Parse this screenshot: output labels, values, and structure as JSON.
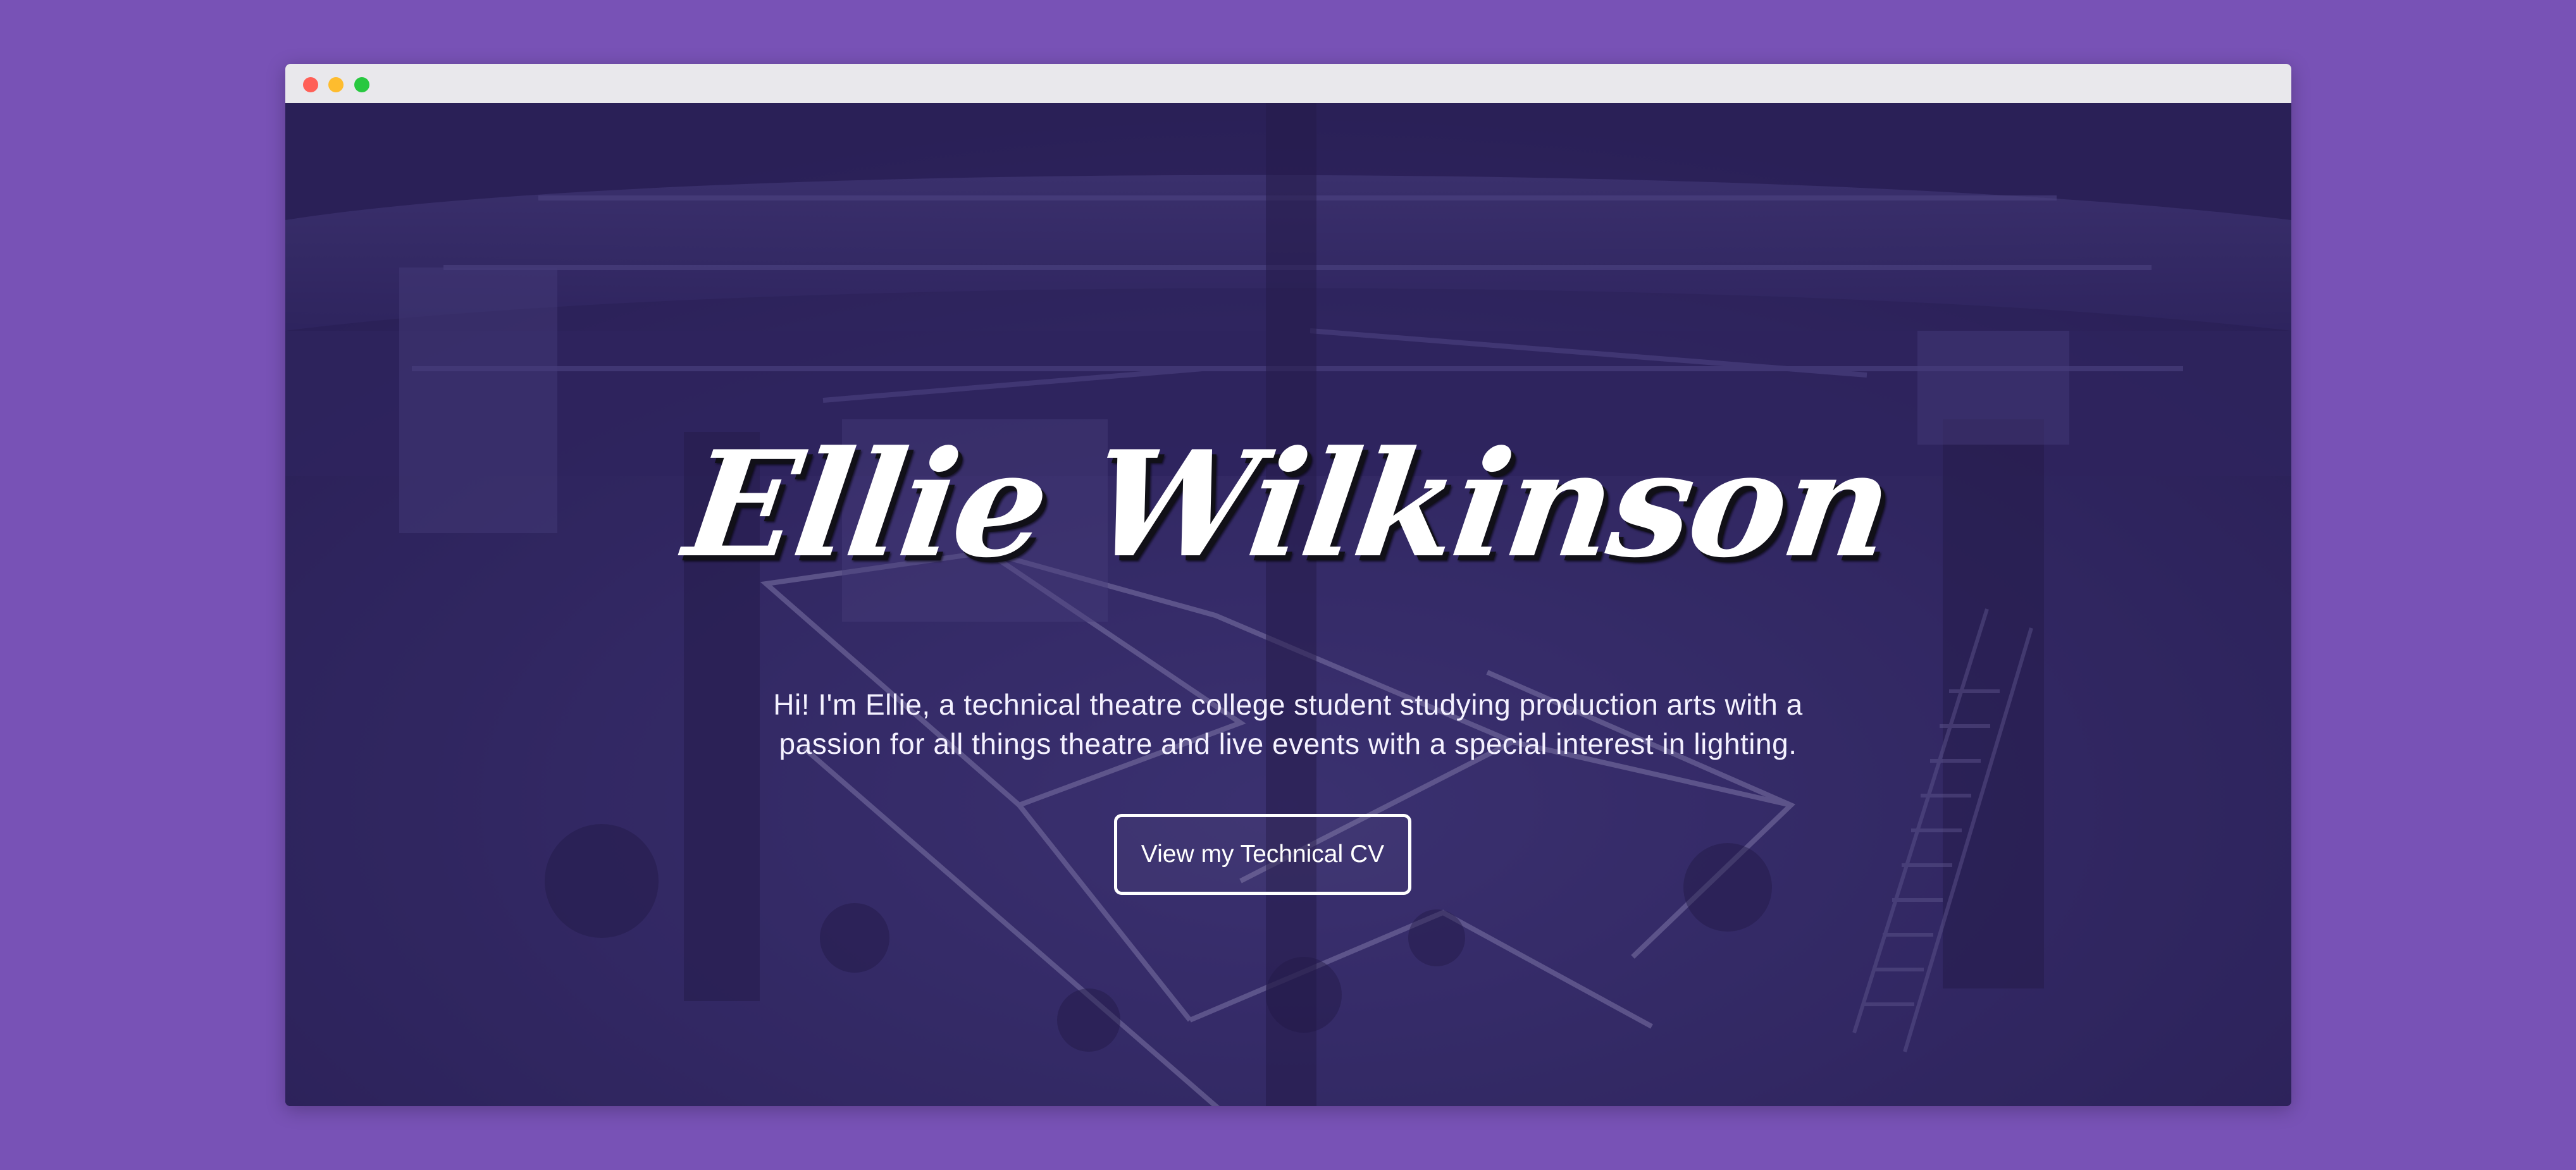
{
  "window": {
    "controls": [
      "close",
      "minimize",
      "zoom"
    ]
  },
  "hero": {
    "name": "Ellie Wilkinson",
    "intro_line_1": "Hi! I'm Ellie, a technical theatre college student studying production arts with a",
    "intro_line_2": "passion for all things theatre and live events with a special interest in lighting.",
    "cta_label": "View my Technical CV"
  },
  "colors": {
    "page_background": "#7852b6",
    "overlay_tint": "#312368",
    "text_primary": "#ffffff"
  },
  "icons": {
    "close": "traffic-light-red",
    "minimize": "traffic-light-yellow",
    "zoom": "traffic-light-green"
  }
}
